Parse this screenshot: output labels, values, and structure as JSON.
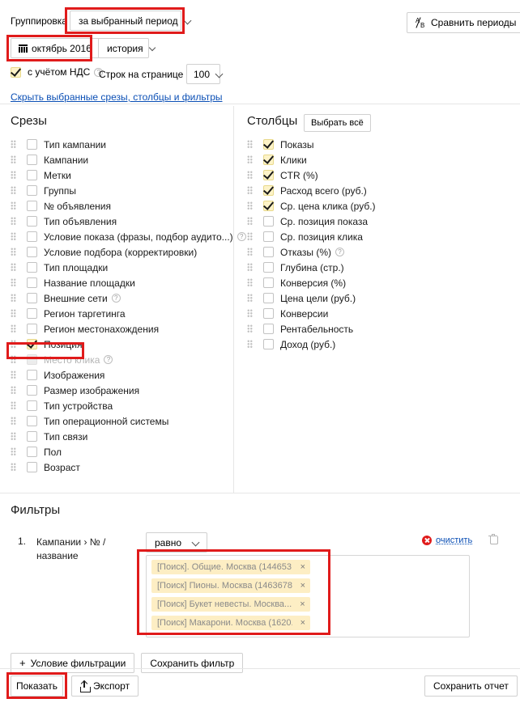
{
  "toolbar": {
    "grouping_label": "Группировка",
    "grouping_value": "за выбранный период",
    "compare_periods_label": "Сравнить периоды",
    "date_value": "октябрь 2016",
    "history_value": "история",
    "vat_label": "с учётом НДС",
    "rows_per_page_label": "Строк на странице",
    "rows_per_page_value": "100",
    "hide_link": "Скрыть выбранные срезы, столбцы и фильтры"
  },
  "slices": {
    "title": "Срезы",
    "items": [
      {
        "label": "Тип кампании",
        "checked": false,
        "help": false,
        "disabled": false
      },
      {
        "label": "Кампании",
        "checked": false,
        "help": false,
        "disabled": false
      },
      {
        "label": "Метки",
        "checked": false,
        "help": false,
        "disabled": false
      },
      {
        "label": "Группы",
        "checked": false,
        "help": false,
        "disabled": false
      },
      {
        "label": "№ объявления",
        "checked": false,
        "help": false,
        "disabled": false
      },
      {
        "label": "Тип объявления",
        "checked": false,
        "help": false,
        "disabled": false
      },
      {
        "label": "Условие показа (фразы, подбор аудито...)",
        "checked": false,
        "help": true,
        "disabled": false
      },
      {
        "label": "Условие подбора (корректировки)",
        "checked": false,
        "help": false,
        "disabled": false
      },
      {
        "label": "Тип площадки",
        "checked": false,
        "help": false,
        "disabled": false
      },
      {
        "label": "Название площадки",
        "checked": false,
        "help": false,
        "disabled": false
      },
      {
        "label": "Внешние сети",
        "checked": false,
        "help": true,
        "disabled": false
      },
      {
        "label": "Регион таргетинга",
        "checked": false,
        "help": false,
        "disabled": false
      },
      {
        "label": "Регион местонахождения",
        "checked": false,
        "help": false,
        "disabled": false
      },
      {
        "label": "Позиция",
        "checked": true,
        "help": false,
        "disabled": false
      },
      {
        "label": "Место клика",
        "checked": false,
        "help": true,
        "disabled": true
      },
      {
        "label": "Изображения",
        "checked": false,
        "help": false,
        "disabled": false
      },
      {
        "label": "Размер изображения",
        "checked": false,
        "help": false,
        "disabled": false
      },
      {
        "label": "Тип устройства",
        "checked": false,
        "help": false,
        "disabled": false
      },
      {
        "label": "Тип операционной системы",
        "checked": false,
        "help": false,
        "disabled": false
      },
      {
        "label": "Тип связи",
        "checked": false,
        "help": false,
        "disabled": false
      },
      {
        "label": "Пол",
        "checked": false,
        "help": false,
        "disabled": false
      },
      {
        "label": "Возраст",
        "checked": false,
        "help": false,
        "disabled": false
      }
    ]
  },
  "columns": {
    "title": "Столбцы",
    "select_all_label": "Выбрать всё",
    "items": [
      {
        "label": "Показы",
        "checked": true,
        "help": false,
        "disabled": false
      },
      {
        "label": "Клики",
        "checked": true,
        "help": false,
        "disabled": false
      },
      {
        "label": "CTR (%)",
        "checked": true,
        "help": false,
        "disabled": false
      },
      {
        "label": "Расход всего (руб.)",
        "checked": true,
        "help": false,
        "disabled": false
      },
      {
        "label": "Ср. цена клика (руб.)",
        "checked": true,
        "help": false,
        "disabled": false
      },
      {
        "label": "Ср. позиция показа",
        "checked": false,
        "help": false,
        "disabled": false
      },
      {
        "label": "Ср. позиция клика",
        "checked": false,
        "help": false,
        "disabled": false
      },
      {
        "label": "Отказы (%)",
        "checked": false,
        "help": true,
        "disabled": false
      },
      {
        "label": "Глубина (стр.)",
        "checked": false,
        "help": false,
        "disabled": false
      },
      {
        "label": "Конверсия (%)",
        "checked": false,
        "help": false,
        "disabled": false
      },
      {
        "label": "Цена цели (руб.)",
        "checked": false,
        "help": false,
        "disabled": false
      },
      {
        "label": "Конверсии",
        "checked": false,
        "help": false,
        "disabled": false
      },
      {
        "label": "Рентабельность",
        "checked": false,
        "help": false,
        "disabled": false
      },
      {
        "label": "Доход (руб.)",
        "checked": false,
        "help": false,
        "disabled": false
      }
    ]
  },
  "filters": {
    "title": "Фильтры",
    "row": {
      "index": "1.",
      "field": "Кампании › № / название",
      "operator": "равно",
      "clear_label": "очистить",
      "tags": [
        "[Поиск]. Общие. Москва (144653...",
        "[Поиск] Пионы. Москва (1463678...",
        "[Поиск] Букет невесты. Москва...",
        "[Поиск] Макарони. Москва (1620...",
        "×"
      ]
    },
    "add_condition_label": "Условие фильтрации",
    "save_filter_label": "Сохранить фильтр"
  },
  "footer": {
    "show_label": "Показать",
    "export_label": "Экспорт",
    "save_report_label": "Сохранить отчет"
  },
  "colors": {
    "highlight": "#e01b1b",
    "checked_fill": "#fdf3c8",
    "tag_fill": "#fdeec4",
    "link": "#0b4fb5"
  }
}
